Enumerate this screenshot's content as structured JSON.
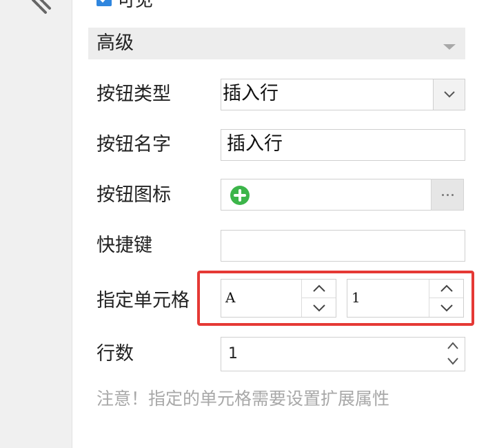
{
  "visible": {
    "label": "可见",
    "checked": true
  },
  "section": {
    "title": "高级"
  },
  "fields": {
    "button_type": {
      "label": "按钮类型",
      "value": "插入行"
    },
    "button_name": {
      "label": "按钮名字",
      "value": "插入行"
    },
    "button_icon": {
      "label": "按钮图标",
      "icon": "plus-circle-icon",
      "icon_color": "#3cb54a",
      "more_label": "···"
    },
    "shortcut": {
      "label": "快捷键",
      "value": ""
    },
    "cell": {
      "label": "指定单元格",
      "column": "A",
      "row": "1",
      "highlight_color": "#e53935"
    },
    "row_count": {
      "label": "行数",
      "value": "1"
    }
  },
  "note": "注意！指定的单元格需要设置扩展属性"
}
